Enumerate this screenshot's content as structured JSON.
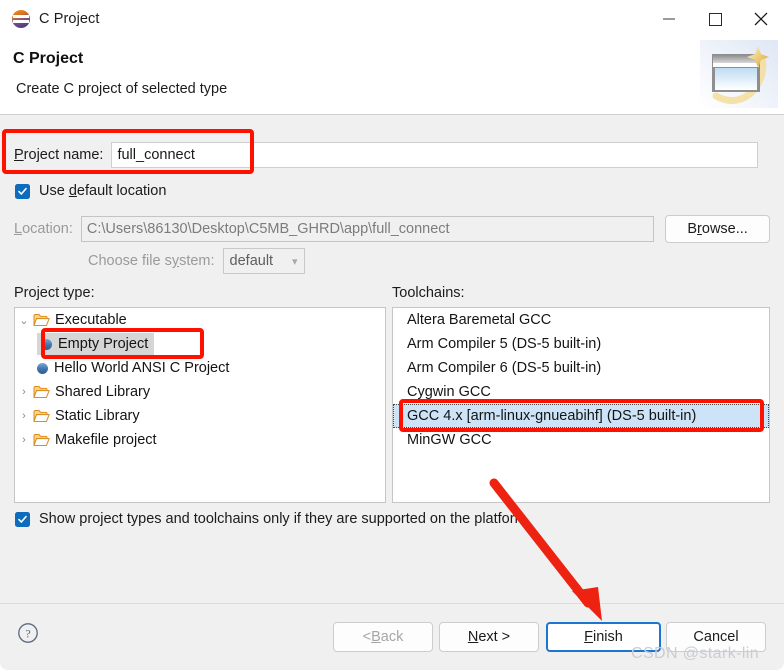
{
  "window": {
    "title": "C Project",
    "icon": "eclipse-icon",
    "controls": {
      "minimize": "minimize-icon",
      "maximize": "maximize-icon",
      "close": "close-icon"
    }
  },
  "header": {
    "title": "C Project",
    "subtitle": "Create C project of selected type",
    "banner_icon": "new-project-wizard-icon"
  },
  "form": {
    "project_name_label": "Project name:",
    "project_name_value": "full_connect",
    "use_default_location_label": "Use default location",
    "use_default_location_checked": true,
    "location_label": "Location:",
    "location_value": "C:\\Users\\86130\\Desktop\\C5MB_GHRD\\app\\full_connect",
    "browse_label": "Browse...",
    "choose_file_system_label": "Choose file system:",
    "file_system_value": "default",
    "file_system_chevron": "chevron-down-icon"
  },
  "project_type": {
    "label": "Project type:",
    "items": [
      {
        "label": "Executable",
        "level": 0,
        "icon": "folder-open-icon",
        "twisty": "chevron-down-icon",
        "selected": false
      },
      {
        "label": "Empty Project",
        "level": 1,
        "icon": "project-dot-icon",
        "twisty": "",
        "selected": true
      },
      {
        "label": "Hello World ANSI C Project",
        "level": 1,
        "icon": "project-dot-icon",
        "twisty": "",
        "selected": false
      },
      {
        "label": "Shared Library",
        "level": 0,
        "icon": "folder-open-icon",
        "twisty": "chevron-right-icon",
        "selected": false
      },
      {
        "label": "Static Library",
        "level": 0,
        "icon": "folder-open-icon",
        "twisty": "chevron-right-icon",
        "selected": false
      },
      {
        "label": "Makefile project",
        "level": 0,
        "icon": "folder-open-icon",
        "twisty": "chevron-right-icon",
        "selected": false
      }
    ]
  },
  "toolchains": {
    "label": "Toolchains:",
    "items": [
      {
        "label": "Altera Baremetal GCC",
        "selected": false
      },
      {
        "label": "Arm Compiler 5 (DS-5 built-in)",
        "selected": false
      },
      {
        "label": "Arm Compiler 6 (DS-5 built-in)",
        "selected": false
      },
      {
        "label": "Cygwin GCC",
        "selected": false
      },
      {
        "label": "GCC 4.x [arm-linux-gnueabihf] (DS-5 built-in)",
        "selected": true
      },
      {
        "label": "MinGW GCC",
        "selected": false
      }
    ]
  },
  "options": {
    "show_supported_label": "Show project types and toolchains only if they are supported on the platform",
    "show_supported_checked": true
  },
  "footer": {
    "help_icon": "help-circle-icon",
    "back_label": "< Back",
    "next_label": "Next >",
    "finish_label": "Finish",
    "cancel_label": "Cancel"
  },
  "annotations": {
    "highlight_color": "#ff1100",
    "arrow_color": "#ee2211",
    "watermark": "CSDN @stark-lin"
  }
}
